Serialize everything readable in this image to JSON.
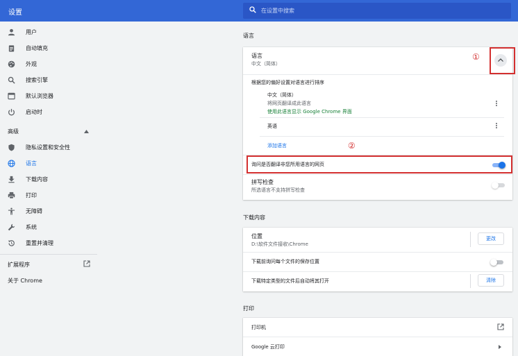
{
  "header": {
    "title": "设置",
    "search_placeholder": "在设置中搜索"
  },
  "sidebar": {
    "items": [
      {
        "label": "用户",
        "icon": "person-icon"
      },
      {
        "label": "自动填充",
        "icon": "clipboard-icon"
      },
      {
        "label": "外观",
        "icon": "palette-icon"
      },
      {
        "label": "搜索引擎",
        "icon": "search-icon"
      },
      {
        "label": "默认浏览器",
        "icon": "browser-icon"
      },
      {
        "label": "启动时",
        "icon": "power-icon"
      }
    ],
    "advanced_label": "高级",
    "advanced_items": [
      {
        "label": "隐私设置和安全性",
        "icon": "shield-icon"
      },
      {
        "label": "语言",
        "icon": "globe-icon",
        "active": true
      },
      {
        "label": "下载内容",
        "icon": "download-icon"
      },
      {
        "label": "打印",
        "icon": "printer-icon"
      },
      {
        "label": "无障碍",
        "icon": "accessibility-icon"
      },
      {
        "label": "系统",
        "icon": "wrench-icon"
      },
      {
        "label": "重置并清理",
        "icon": "restore-icon"
      }
    ],
    "extensions_label": "扩展程序",
    "about_label": "关于 Chrome"
  },
  "languages": {
    "section_title": "语言",
    "card_title": "语言",
    "card_value": "中文（简体）",
    "order_hint": "根据您的偏好设置对语言进行排序",
    "list": [
      {
        "name": "中文（简体）",
        "note": "将网页翻译成此语言",
        "display": "使用此语言显示 Google Chrome 界面"
      },
      {
        "name": "英语"
      }
    ],
    "add_language": "添加语言",
    "offer_translate": "询问是否翻译非您所用语言的网页",
    "offer_translate_on": true,
    "spellcheck_title": "拼写检查",
    "spellcheck_sub": "所选语言不支持拼写检查",
    "spellcheck_on": false
  },
  "downloads": {
    "section_title": "下载内容",
    "location_label": "位置",
    "location_value": "D:\\软件文件接收\\Chrome",
    "change_button": "更改",
    "ask_where_label": "下载前询问每个文件的保存位置",
    "ask_where_on": false,
    "auto_open_label": "下载特定类型的文件后自动将其打开",
    "clear_button": "清除"
  },
  "printing": {
    "section_title": "打印",
    "printers_label": "打印机",
    "cloud_print_label": "Google 云打印"
  },
  "annotations": {
    "one": "①",
    "two": "②"
  },
  "colors": {
    "header": "#3367d6",
    "accent": "#1a73e8",
    "annotation": "#d32f2f"
  }
}
